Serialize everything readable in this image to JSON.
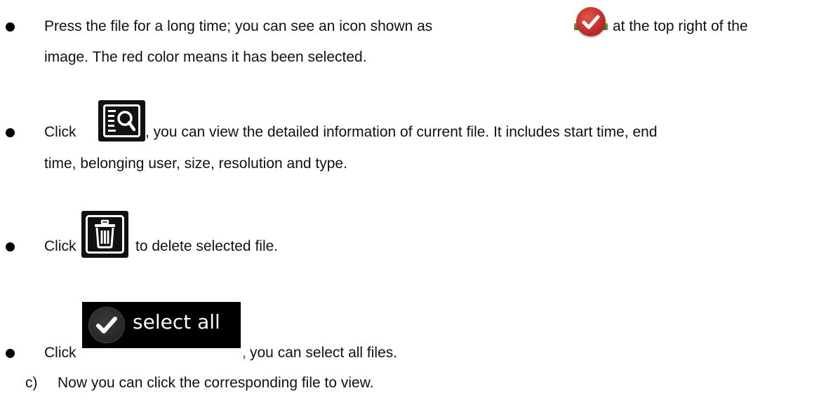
{
  "items": [
    {
      "line1_before": "Press the file for a long time; you can see an icon shown as",
      "line1_after": "at the top right of the",
      "line2": "image. The red color means it has been selected.",
      "icon": "red-check-badge-icon"
    },
    {
      "line1_before": "Click",
      "line1_after": ", you can view the detailed information of current file. It includes start time, end",
      "line2": "time, belonging user, size, resolution and type.",
      "icon": "detail-search-icon"
    },
    {
      "line1_before": "Click",
      "line1_after": "to delete selected file.",
      "icon": "trash-icon"
    },
    {
      "line1_before": "Click",
      "button_label": "select all",
      "comma": ",",
      "line1_after": "you can select all files.",
      "icon": "checkmark-icon"
    }
  ],
  "step": {
    "marker": "c)",
    "text": "Now you can click the corresponding file to view."
  },
  "colors": {
    "badge_red": "#c0302a",
    "badge_green": "#4f8f35",
    "comma_red": "#d42020",
    "button_bg": "#000000"
  }
}
